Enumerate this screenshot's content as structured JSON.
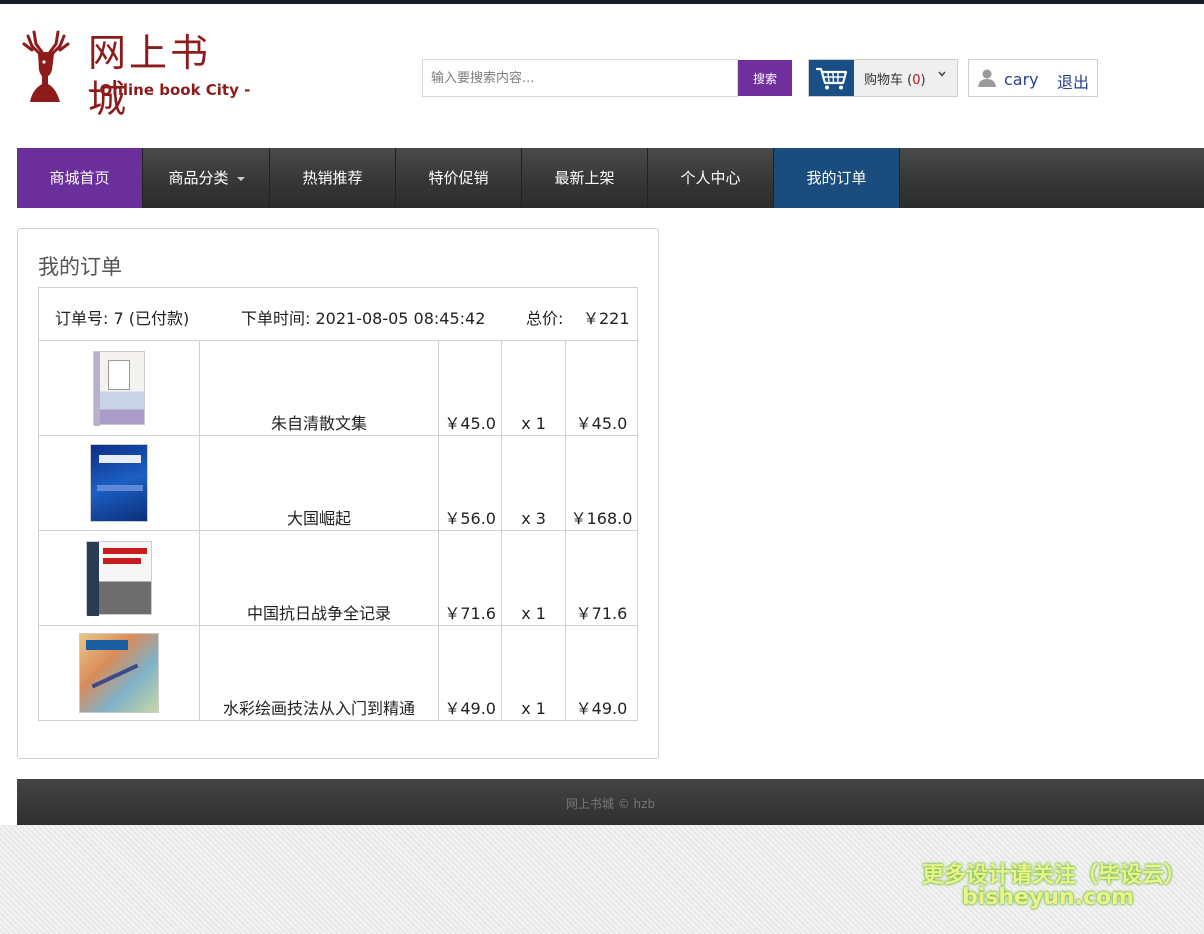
{
  "logo": {
    "zh": "网上书城",
    "en": "- Online book City -"
  },
  "search": {
    "placeholder": "输入要搜索内容...",
    "button": "搜索"
  },
  "cart": {
    "label": "购物车",
    "count_open": "(",
    "count": "0",
    "count_close": ")"
  },
  "user": {
    "name": "cary",
    "logout": "退出"
  },
  "nav": {
    "items": [
      "商城首页",
      "商品分类",
      "热销推荐",
      "特价促销",
      "最新上架",
      "个人中心",
      "我的订单"
    ],
    "active_color": "#6a2f9b",
    "current_color": "#1a4d7d"
  },
  "orders": {
    "title": "我的订单",
    "list": [
      {
        "order_no": "订单号: 7 (已付款)",
        "order_time": "下单时间: 2021-08-05 08:45:42",
        "total_label": "总价:",
        "total": "￥221",
        "items": [
          {
            "name": "朱自清散文集",
            "price": "￥45.0",
            "qty": "x 1",
            "subtotal": "￥45.0"
          },
          {
            "name": "大国崛起",
            "price": "￥56.0",
            "qty": "x 3",
            "subtotal": "￥168.0"
          },
          {
            "name": "中国抗日战争全记录",
            "price": "￥71.6",
            "qty": "x 1",
            "subtotal": "￥71.6"
          },
          {
            "name": "水彩绘画技法从入门到精通",
            "price": "￥49.0",
            "qty": "x 1",
            "subtotal": "￥49.0"
          }
        ]
      }
    ]
  },
  "footer": {
    "text": "网上书城 © hzb"
  },
  "watermark": {
    "line1": "更多设计请关注（毕设云）",
    "line2": "bisheyun.com"
  }
}
